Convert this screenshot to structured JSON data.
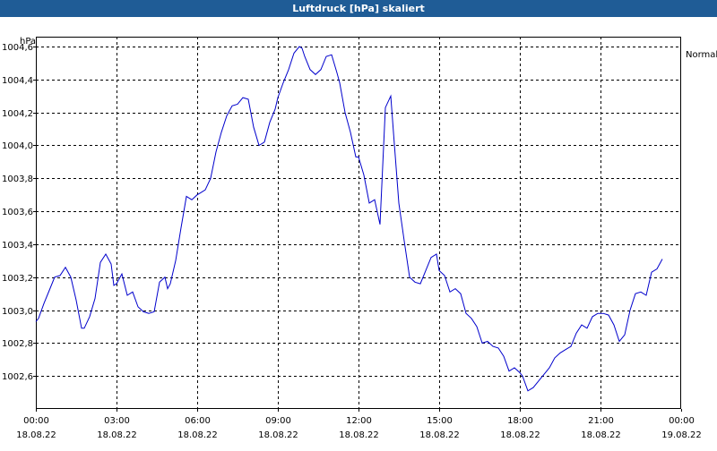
{
  "window": {
    "title": "Luftdruck [hPa] skaliert"
  },
  "chart_data": {
    "type": "line",
    "title": "Luftdruck [hPa] skaliert",
    "ylabel": "hPa",
    "ylim": [
      1002.4,
      1004.66
    ],
    "yticks": [
      "1002,6",
      "1002,8",
      "1003,0",
      "1003,2",
      "1003,4",
      "1003,6",
      "1003,8",
      "1004,0",
      "1004,2",
      "1004,4",
      "1004,6"
    ],
    "ytick_values": [
      1002.6,
      1002.8,
      1003.0,
      1003.2,
      1003.4,
      1003.6,
      1003.8,
      1004.0,
      1004.2,
      1004.4,
      1004.6
    ],
    "xlim_hours": [
      0,
      24
    ],
    "xticks": [
      {
        "hour": 0,
        "time": "00:00",
        "date": "18.08.22"
      },
      {
        "hour": 3,
        "time": "03:00",
        "date": "18.08.22"
      },
      {
        "hour": 6,
        "time": "06:00",
        "date": "18.08.22"
      },
      {
        "hour": 9,
        "time": "09:00",
        "date": "18.08.22"
      },
      {
        "hour": 12,
        "time": "12:00",
        "date": "18.08.22"
      },
      {
        "hour": 15,
        "time": "15:00",
        "date": "18.08.22"
      },
      {
        "hour": 18,
        "time": "18:00",
        "date": "18.08.22"
      },
      {
        "hour": 21,
        "time": "21:00",
        "date": "18.08.22"
      },
      {
        "hour": 24,
        "time": "00:00",
        "date": "19.08.22"
      }
    ],
    "legend": {
      "position": "top-right",
      "label": "Normal"
    },
    "grid": true,
    "line_color": "#0000cc",
    "series": [
      {
        "name": "Normal",
        "x_hours": [
          0.0,
          0.1,
          0.3,
          0.5,
          0.7,
          0.9,
          1.1,
          1.3,
          1.5,
          1.7,
          1.8,
          2.0,
          2.2,
          2.4,
          2.6,
          2.8,
          2.9,
          3.0,
          3.2,
          3.4,
          3.6,
          3.8,
          4.0,
          4.2,
          4.4,
          4.6,
          4.8,
          4.9,
          5.0,
          5.2,
          5.4,
          5.6,
          5.8,
          6.0,
          6.1,
          6.3,
          6.5,
          6.7,
          6.9,
          7.1,
          7.3,
          7.5,
          7.7,
          7.9,
          8.1,
          8.3,
          8.5,
          8.7,
          8.9,
          9.0,
          9.2,
          9.4,
          9.6,
          9.8,
          9.9,
          10.0,
          10.2,
          10.4,
          10.6,
          10.8,
          11.0,
          11.2,
          11.3,
          11.5,
          11.7,
          11.9,
          12.0,
          12.2,
          12.4,
          12.6,
          12.8,
          13.0,
          13.2,
          13.3,
          13.5,
          13.7,
          13.9,
          14.1,
          14.3,
          14.5,
          14.7,
          14.9,
          15.0,
          15.2,
          15.4,
          15.6,
          15.8,
          16.0,
          16.2,
          16.4,
          16.6,
          16.8,
          17.0,
          17.2,
          17.4,
          17.6,
          17.8,
          18.0,
          18.1,
          18.3,
          18.5,
          18.7,
          18.9,
          19.1,
          19.3,
          19.5,
          19.7,
          19.9,
          20.1,
          20.3,
          20.5,
          20.7,
          20.9,
          21.1,
          21.3,
          21.5,
          21.7,
          21.9,
          22.1,
          22.3,
          22.5,
          22.7,
          22.9,
          23.1,
          23.3,
          23.5,
          23.7,
          23.9
        ],
        "values": [
          1002.93,
          1002.95,
          1003.04,
          1003.12,
          1003.2,
          1003.21,
          1003.26,
          1003.2,
          1003.06,
          1002.89,
          1002.89,
          1002.96,
          1003.07,
          1003.29,
          1003.34,
          1003.28,
          1003.15,
          1003.16,
          1003.22,
          1003.09,
          1003.11,
          1003.02,
          1002.99,
          1002.98,
          1002.99,
          1003.17,
          1003.2,
          1003.13,
          1003.16,
          1003.3,
          1003.5,
          1003.69,
          1003.67,
          1003.7,
          1003.71,
          1003.73,
          1003.8,
          1003.96,
          1004.08,
          1004.18,
          1004.24,
          1004.25,
          1004.29,
          1004.28,
          1004.11,
          1004.0,
          1004.02,
          1004.14,
          1004.22,
          1004.29,
          1004.38,
          1004.46,
          1004.56,
          1004.6,
          1004.59,
          1004.54,
          1004.46,
          1004.43,
          1004.46,
          1004.54,
          1004.55,
          1004.44,
          1004.38,
          1004.2,
          1004.08,
          1003.93,
          1003.93,
          1003.82,
          1003.65,
          1003.67,
          1003.52,
          1004.23,
          1004.3,
          1004.08,
          1003.65,
          1003.42,
          1003.2,
          1003.17,
          1003.16,
          1003.24,
          1003.32,
          1003.34,
          1003.24,
          1003.21,
          1003.11,
          1003.13,
          1003.1,
          1002.98,
          1002.95,
          1002.9,
          1002.8,
          1002.81,
          1002.78,
          1002.77,
          1002.72,
          1002.63,
          1002.65,
          1002.62,
          1002.6,
          1002.51,
          1002.53,
          1002.57,
          1002.61,
          1002.65,
          1002.71,
          1002.74,
          1002.76,
          1002.78,
          1002.86,
          1002.91,
          1002.89,
          1002.96,
          1002.98,
          1002.98,
          1002.97,
          1002.91,
          1002.81,
          1002.85,
          1003.0,
          1003.1,
          1003.11,
          1003.09,
          1003.23,
          1003.25,
          1003.31
        ]
      }
    ]
  }
}
